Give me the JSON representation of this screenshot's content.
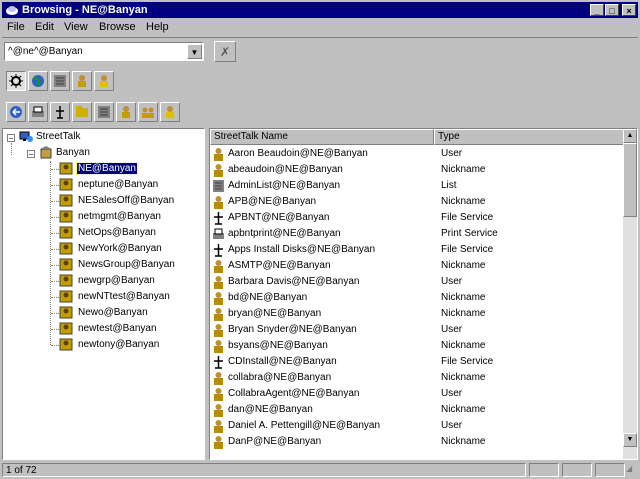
{
  "window": {
    "title": "Browsing - NE@Banyan"
  },
  "menu": [
    "File",
    "Edit",
    "View",
    "Browse",
    "Help"
  ],
  "address": {
    "value": "^@ne^@Banyan"
  },
  "toolbar1": [
    "gear-icon",
    "globe-icon",
    "list-icon",
    "user-icon",
    "user-icon"
  ],
  "toolbar2": [
    "back-icon",
    "printer-icon",
    "fileservice-icon",
    "folder-icon",
    "list-icon",
    "user-icon",
    "group-icon",
    "user-icon"
  ],
  "tree": {
    "root": "StreetTalk",
    "org": "Banyan",
    "items": [
      "NE@Banyan",
      "neptune@Banyan",
      "NESalesOff@Banyan",
      "netmgmt@Banyan",
      "NetOps@Banyan",
      "NewYork@Banyan",
      "NewsGroup@Banyan",
      "newgrp@Banyan",
      "newNTtest@Banyan",
      "Newo@Banyan",
      "newtest@Banyan",
      "newtony@Banyan"
    ],
    "selected_index": 0
  },
  "list": {
    "columns": {
      "name": "StreetTalk Name",
      "type": "Type"
    },
    "rows": [
      {
        "name": "Aaron Beaudoin@NE@Banyan",
        "type": "User",
        "icon": "user"
      },
      {
        "name": "abeaudoin@NE@Banyan",
        "type": "Nickname",
        "icon": "user"
      },
      {
        "name": "AdminList@NE@Banyan",
        "type": "List",
        "icon": "list"
      },
      {
        "name": "APB@NE@Banyan",
        "type": "Nickname",
        "icon": "user"
      },
      {
        "name": "APBNT@NE@Banyan",
        "type": "File Service",
        "icon": "service"
      },
      {
        "name": "apbntprint@NE@Banyan",
        "type": "Print Service",
        "icon": "printer"
      },
      {
        "name": "Apps Install Disks@NE@Banyan",
        "type": "File Service",
        "icon": "service"
      },
      {
        "name": "ASMTP@NE@Banyan",
        "type": "Nickname",
        "icon": "user"
      },
      {
        "name": "Barbara Davis@NE@Banyan",
        "type": "User",
        "icon": "user"
      },
      {
        "name": "bd@NE@Banyan",
        "type": "Nickname",
        "icon": "user"
      },
      {
        "name": "bryan@NE@Banyan",
        "type": "Nickname",
        "icon": "user"
      },
      {
        "name": "Bryan Snyder@NE@Banyan",
        "type": "User",
        "icon": "user"
      },
      {
        "name": "bsyans@NE@Banyan",
        "type": "Nickname",
        "icon": "user"
      },
      {
        "name": "CDInstall@NE@Banyan",
        "type": "File Service",
        "icon": "service"
      },
      {
        "name": "collabra@NE@Banyan",
        "type": "Nickname",
        "icon": "user"
      },
      {
        "name": "CollabraAgent@NE@Banyan",
        "type": "User",
        "icon": "user"
      },
      {
        "name": "dan@NE@Banyan",
        "type": "Nickname",
        "icon": "user"
      },
      {
        "name": "Daniel A. Pettengill@NE@Banyan",
        "type": "User",
        "icon": "user"
      },
      {
        "name": "DanP@NE@Banyan",
        "type": "Nickname",
        "icon": "user"
      }
    ]
  },
  "status": {
    "count": "1 of 72"
  }
}
